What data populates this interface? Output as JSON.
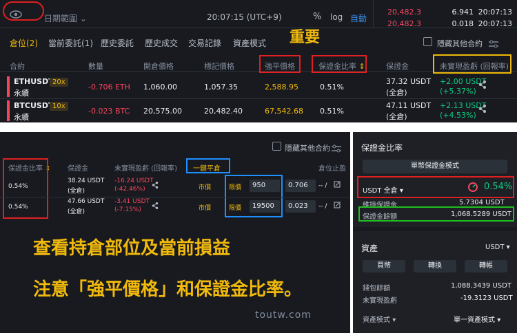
{
  "toolbar": {
    "date_range": "日期範圍",
    "clock": "20:07:15 (UTC+9)",
    "percent": "%",
    "log": "log",
    "auto": "自動"
  },
  "orderbook": {
    "rows": [
      {
        "price": "20,482.3",
        "qty": "6.941",
        "time": "20:07:13"
      },
      {
        "price": "20,482.3",
        "qty": "0.018",
        "time": "20:07:13"
      }
    ]
  },
  "tabs": {
    "positions": "倉位(2)",
    "open_orders": "當前委託(1)",
    "order_history": "歷史委託",
    "trade_history": "歷史成交",
    "transactions": "交易記錄",
    "assets": "資產模式"
  },
  "annotation_important": "重要",
  "hide_other": "隱藏其他合約",
  "table": {
    "headers": {
      "symbol": "合約",
      "size": "數量",
      "entry": "開倉價格",
      "mark": "標記價格",
      "liq": "強平價格",
      "margin_ratio": "保證金比率",
      "margin": "保證金",
      "pnl": "未實現盈虧 (回報率)"
    },
    "rows": [
      {
        "symbol": "ETHUSDT",
        "perp": "永續",
        "leverage": "20x",
        "size": "-0.706 ETH",
        "entry": "1,060.00",
        "mark": "1,057.35",
        "liq": "2,588.95",
        "margin_ratio": "0.51%",
        "margin": "37.32 USDT",
        "margin_mode": "(全倉)",
        "pnl": "+2.00 USDT",
        "roe": "(+5.37%)"
      },
      {
        "symbol": "BTCUSDT",
        "perp": "永續",
        "leverage": "10x",
        "size": "-0.023 BTC",
        "entry": "20,575.00",
        "mark": "20,482.40",
        "liq": "67,542.68",
        "margin_ratio": "0.51%",
        "margin": "47.11 USDT",
        "margin_mode": "(全倉)",
        "pnl": "+2.13 USDT",
        "roe": "(+4.53%)"
      }
    ]
  },
  "bottom": {
    "hide_other": "隱藏其他合約",
    "headers": {
      "margin_ratio": "保證金比率",
      "margin": "保證金",
      "pnl": "未實現盈虧 (回報率)",
      "close_all": "一鍵平倉",
      "tpsl": "倉位止盈"
    },
    "rows": [
      {
        "margin_ratio": "0.54%",
        "margin": "38.24 USDT",
        "margin_mode": "(全倉)",
        "pnl": "-16.24 USDT",
        "roe": "(-42.46%)",
        "market": "市價",
        "limit": "限價",
        "price": "950",
        "qty": "0.706",
        "dash": "-- /"
      },
      {
        "margin_ratio": "0.54%",
        "margin": "47.66 USDT",
        "margin_mode": "(全倉)",
        "pnl": "-3.41 USDT",
        "roe": "(-7.15%)",
        "market": "市價",
        "limit": "限價",
        "price": "19500",
        "qty": "0.023",
        "dash": "-- /"
      }
    ],
    "caption1": "查看持倉部位及當前損益",
    "caption2": "注意「強平價格」和保證金比率。",
    "watermark": "toutw.com"
  },
  "right_panel": {
    "title": "保證金比率",
    "single_margin": "單幣保證金模式",
    "usdt_cross": "USDT 全倉",
    "ratio": "0.54%",
    "maint_label": "維持保證金",
    "maint_val": "5.7304 USDT",
    "balance_label": "保證金餘額",
    "balance_val": "1,068.5289 USDT",
    "assets_title": "資產",
    "asset_unit": "USDT",
    "buy": "買幣",
    "transfer": "轉換",
    "swap": "轉帳",
    "wallet_label": "錢包餘額",
    "wallet_val": "1,088.3439 USDT",
    "upnl_label": "未實現盈虧",
    "upnl_val": "-19.3123 USDT",
    "asset_mode_label": "資產模式",
    "asset_mode_val": "單一資產模式"
  }
}
